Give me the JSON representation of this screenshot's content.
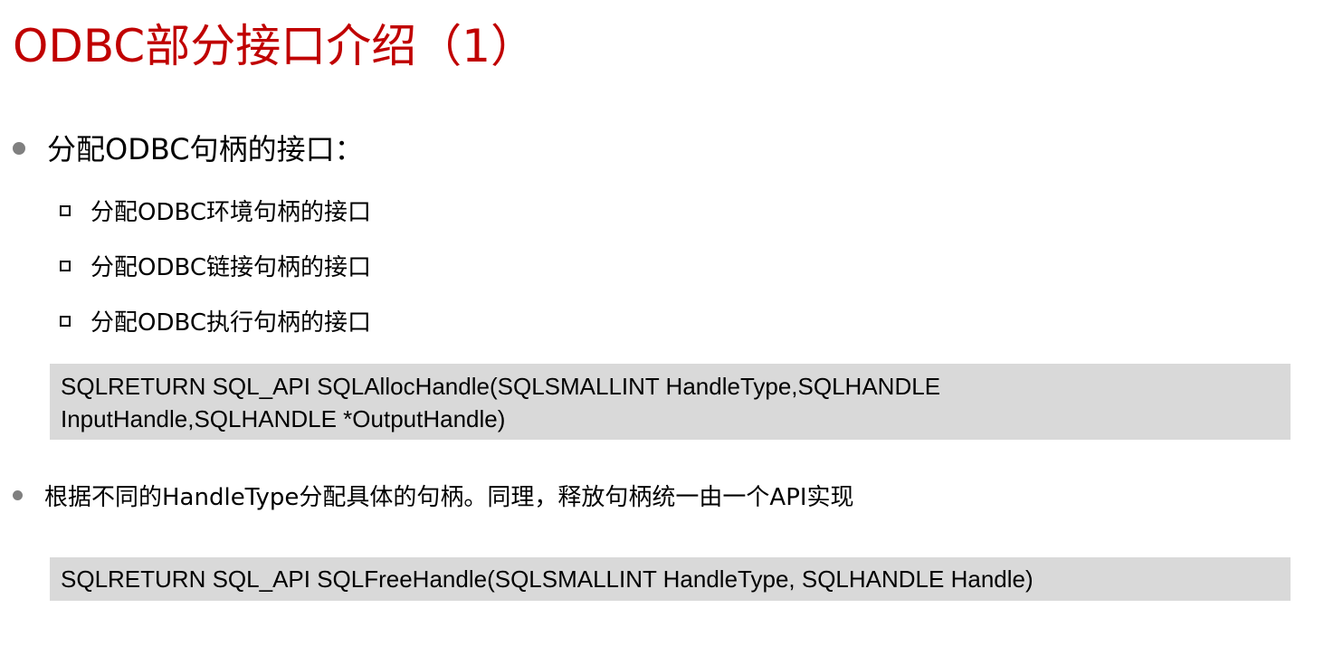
{
  "title": "ODBC部分接口介绍（1）",
  "bullet1": {
    "text": "分配ODBC句柄的接口：",
    "items": [
      "分配ODBC环境句柄的接口",
      "分配ODBC链接句柄的接口",
      "分配ODBC执行句柄的接口"
    ]
  },
  "code1": {
    "line1": "SQLRETURN SQL_API SQLAllocHandle(SQLSMALLINT HandleType,SQLHANDLE",
    "line2": "InputHandle,SQLHANDLE *OutputHandle)"
  },
  "bullet2": {
    "text": "根据不同的HandleType分配具体的句柄。同理，释放句柄统一由一个API实现"
  },
  "code2": {
    "line1": "SQLRETURN SQL_API SQLFreeHandle(SQLSMALLINT HandleType, SQLHANDLE Handle)"
  },
  "colors": {
    "title": "#c00000",
    "code_bg": "#d9d9d9",
    "bullet": "#808080"
  }
}
